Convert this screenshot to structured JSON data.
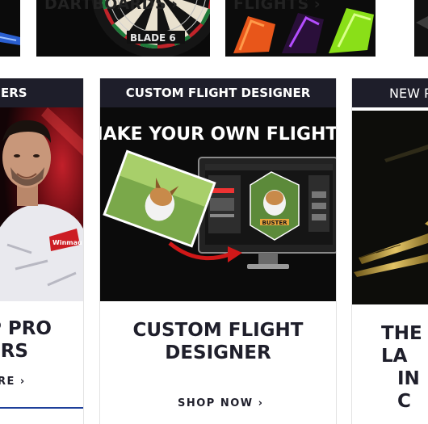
{
  "top_row": {
    "dartboards_label": "DARTBOARDS",
    "flights_label": "FLIGHTS",
    "board_brand": "BLADE 6",
    "chevron": "›"
  },
  "panels": {
    "players": {
      "header": "ERS",
      "title_line1": "P PRO",
      "title_line2": "ERS",
      "shop_label": "RE",
      "chevron": "›",
      "shirt_brand": "Winmau"
    },
    "custom": {
      "header": "CUSTOM FLIGHT DESIGNER",
      "banner_title": "MAKE YOUR OWN FLIGHTS",
      "flight_name": "BUSTER",
      "title_line1": "CUSTOM FLIGHT",
      "title_line2": "DESIGNER",
      "shop_label": "SHOP NOW",
      "chevron": "›"
    },
    "new": {
      "header": "NEW P",
      "title_line1": "THE LA",
      "title_line2": "IN C"
    }
  },
  "colors": {
    "header_bg": "#1e1e2a",
    "text_dark": "#1f1f2b",
    "accent_blue": "#1d3f9a"
  }
}
